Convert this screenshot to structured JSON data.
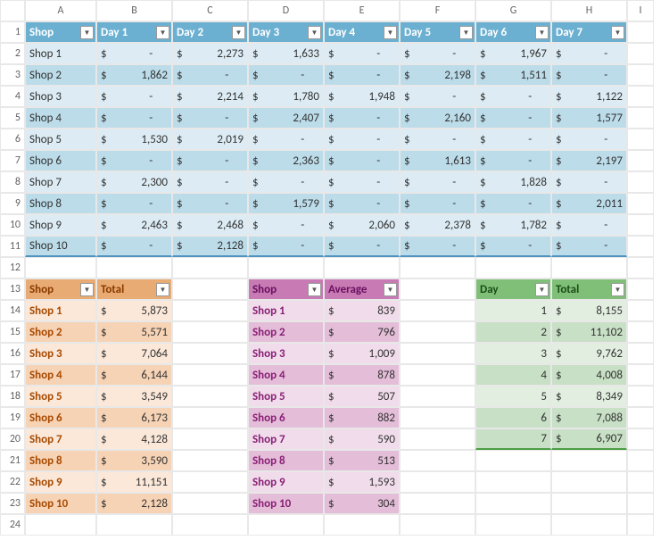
{
  "columns": [
    "A",
    "B",
    "C",
    "D",
    "E",
    "F",
    "G",
    "H",
    "I"
  ],
  "main": {
    "headers": [
      "Shop",
      "Day 1",
      "Day 2",
      "Day 3",
      "Day 4",
      "Day 5",
      "Day 6",
      "Day 7"
    ],
    "rows": [
      {
        "shop": "Shop 1",
        "v": [
          null,
          2273,
          1633,
          null,
          null,
          1967,
          null
        ]
      },
      {
        "shop": "Shop 2",
        "v": [
          1862,
          null,
          null,
          null,
          2198,
          1511,
          null
        ]
      },
      {
        "shop": "Shop 3",
        "v": [
          null,
          2214,
          1780,
          1948,
          null,
          null,
          1122
        ]
      },
      {
        "shop": "Shop 4",
        "v": [
          null,
          null,
          2407,
          null,
          2160,
          null,
          1577
        ]
      },
      {
        "shop": "Shop 5",
        "v": [
          1530,
          2019,
          null,
          null,
          null,
          null,
          null
        ]
      },
      {
        "shop": "Shop 6",
        "v": [
          null,
          null,
          2363,
          null,
          1613,
          null,
          2197
        ]
      },
      {
        "shop": "Shop 7",
        "v": [
          2300,
          null,
          null,
          null,
          null,
          1828,
          null
        ]
      },
      {
        "shop": "Shop 8",
        "v": [
          null,
          null,
          1579,
          null,
          null,
          null,
          2011
        ]
      },
      {
        "shop": "Shop 9",
        "v": [
          2463,
          2468,
          null,
          2060,
          2378,
          1782,
          null
        ]
      },
      {
        "shop": "Shop 10",
        "v": [
          null,
          2128,
          null,
          null,
          null,
          null,
          null
        ]
      }
    ]
  },
  "totals": {
    "headers": [
      "Shop",
      "Total"
    ],
    "rows": [
      {
        "shop": "Shop 1",
        "val": 5873
      },
      {
        "shop": "Shop 2",
        "val": 5571
      },
      {
        "shop": "Shop 3",
        "val": 7064
      },
      {
        "shop": "Shop 4",
        "val": 6144
      },
      {
        "shop": "Shop 5",
        "val": 3549
      },
      {
        "shop": "Shop 6",
        "val": 6173
      },
      {
        "shop": "Shop 7",
        "val": 4128
      },
      {
        "shop": "Shop 8",
        "val": 3590
      },
      {
        "shop": "Shop 9",
        "val": 11151
      },
      {
        "shop": "Shop 10",
        "val": 2128
      }
    ]
  },
  "average": {
    "headers": [
      "Shop",
      "Average"
    ],
    "rows": [
      {
        "shop": "Shop 1",
        "val": 839
      },
      {
        "shop": "Shop 2",
        "val": 796
      },
      {
        "shop": "Shop 3",
        "val": 1009
      },
      {
        "shop": "Shop 4",
        "val": 878
      },
      {
        "shop": "Shop 5",
        "val": 507
      },
      {
        "shop": "Shop 6",
        "val": 882
      },
      {
        "shop": "Shop 7",
        "val": 590
      },
      {
        "shop": "Shop 8",
        "val": 513
      },
      {
        "shop": "Shop 9",
        "val": 1593
      },
      {
        "shop": "Shop 10",
        "val": 304
      }
    ]
  },
  "dayTotals": {
    "headers": [
      "Day",
      "Total"
    ],
    "rows": [
      {
        "day": 1,
        "val": 8155
      },
      {
        "day": 2,
        "val": 11102
      },
      {
        "day": 3,
        "val": 9762
      },
      {
        "day": 4,
        "val": 4008
      },
      {
        "day": 5,
        "val": 8349
      },
      {
        "day": 6,
        "val": 7088
      },
      {
        "day": 7,
        "val": 6907
      }
    ]
  },
  "currency": "$"
}
